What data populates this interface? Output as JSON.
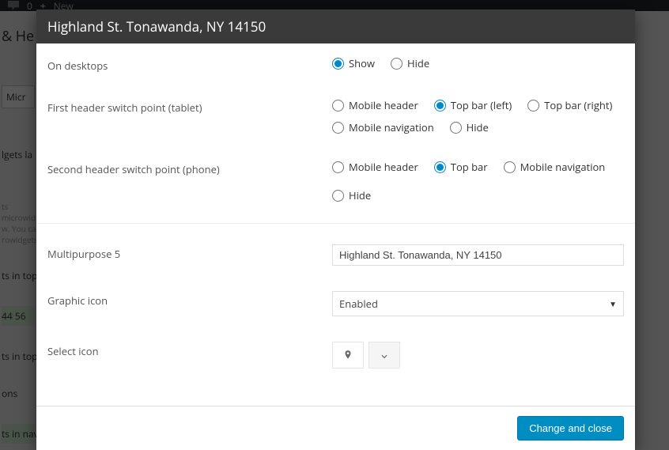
{
  "background": {
    "topbar_count": "0",
    "topbar_new": "New",
    "header_frag": "& He",
    "sidebar_frag": "Micr",
    "lgets_la": "lgets la",
    "ts": "ts",
    "small1": "microwid",
    "small2": "w. You ca",
    "small3": "rowidgets",
    "intop1": "ts in top b",
    "num": "44 56",
    "intop2": "ts in top b",
    "ons": "ons",
    "innav": "ts in navig"
  },
  "modal": {
    "title": "Highland St. Tonawanda, NY 14150",
    "rows": {
      "desktops": {
        "label": "On desktops",
        "options": [
          "Show",
          "Hide"
        ],
        "selected": "Show"
      },
      "tablet": {
        "label": "First header switch point (tablet)",
        "line1": [
          "Mobile header",
          "Top bar (left)",
          "Top bar (right)"
        ],
        "line2": [
          "Mobile navigation",
          "Hide"
        ],
        "selected": "Top bar (left)"
      },
      "phone": {
        "label": "Second header switch point (phone)",
        "options": [
          "Mobile header",
          "Top bar",
          "Mobile navigation",
          "Hide"
        ],
        "selected": "Top bar"
      },
      "multipurpose": {
        "label": "Multipurpose 5",
        "value": "Highland St. Tonawanda, NY 14150"
      },
      "graphic_icon": {
        "label": "Graphic icon",
        "value": "Enabled"
      },
      "select_icon": {
        "label": "Select icon"
      }
    },
    "footer_button": "Change and close"
  }
}
